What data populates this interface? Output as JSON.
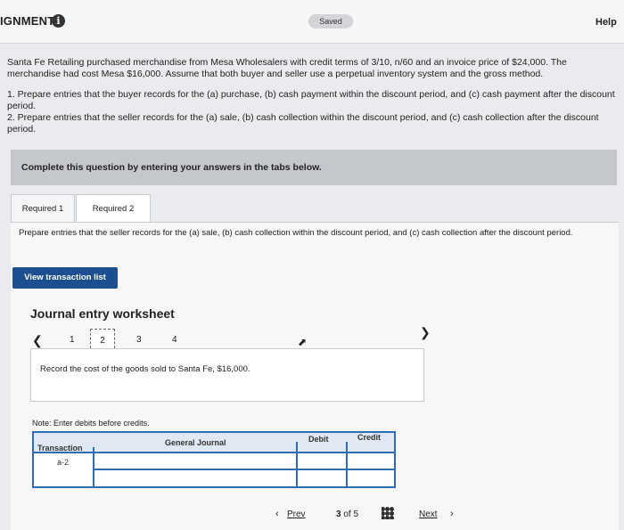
{
  "header": {
    "title": "IGNMENT",
    "saved": "Saved",
    "help": "Help"
  },
  "problem": {
    "intro": "Santa Fe Retailing purchased merchandise from Mesa Wholesalers with credit terms of 3/10, n/60 and an invoice price of $24,000. The merchandise had cost Mesa $16,000. Assume that both buyer and seller use a perpetual inventory system and the gross method.",
    "req1": "1. Prepare entries that the buyer records for the (a) purchase, (b) cash payment within the discount period, and (c) cash payment after the discount period.",
    "req2": "2. Prepare entries that the seller records for the (a) sale, (b) cash collection within the discount period, and (c) cash collection after the discount period."
  },
  "instructions": "Complete this question by entering your answers in the tabs below.",
  "tabs": [
    {
      "label": "Required 1"
    },
    {
      "label": "Required 2"
    }
  ],
  "panel": {
    "prompt": "Prepare entries that the seller records for the (a) sale, (b) cash collection within the discount period, and (c) cash collection after the discount period.",
    "view_button": "View transaction list",
    "worksheet_title": "Journal entry worksheet",
    "pages": [
      "1",
      "2",
      "3",
      "4"
    ],
    "record": "Record the cost of the goods sold to Santa Fe, $16,000.",
    "note": "Note: Enter debits before credits."
  },
  "table": {
    "headers": {
      "transaction": "Transaction",
      "journal": "General Journal",
      "debit": "Debit",
      "credit": "Credit"
    },
    "rows": [
      {
        "transaction": "a-2"
      }
    ]
  },
  "footer": {
    "prev": "Prev",
    "current": "3",
    "of": "of",
    "total": "5",
    "next": "Next"
  }
}
